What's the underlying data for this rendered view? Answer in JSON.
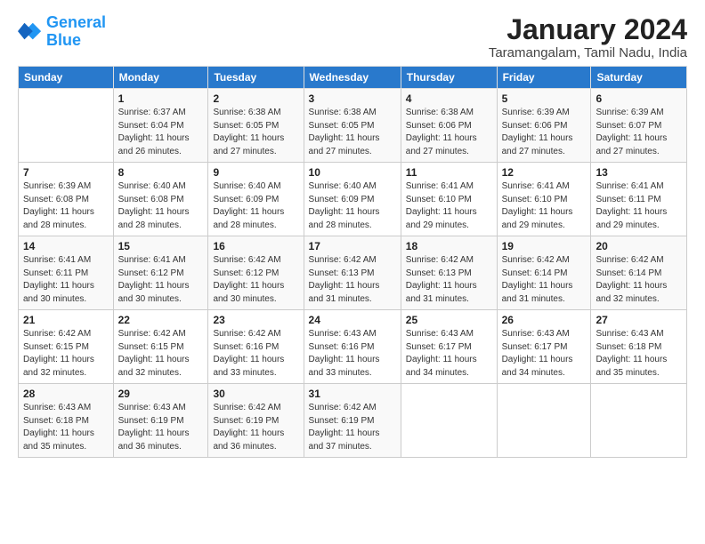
{
  "logo": {
    "line1": "General",
    "line2": "Blue"
  },
  "title": "January 2024",
  "subtitle": "Taramangalam, Tamil Nadu, India",
  "header": {
    "colors": {
      "bg": "#2979cc"
    }
  },
  "days_of_week": [
    "Sunday",
    "Monday",
    "Tuesday",
    "Wednesday",
    "Thursday",
    "Friday",
    "Saturday"
  ],
  "weeks": [
    [
      {
        "day": "",
        "info": ""
      },
      {
        "day": "1",
        "info": "Sunrise: 6:37 AM\nSunset: 6:04 PM\nDaylight: 11 hours\nand 26 minutes."
      },
      {
        "day": "2",
        "info": "Sunrise: 6:38 AM\nSunset: 6:05 PM\nDaylight: 11 hours\nand 27 minutes."
      },
      {
        "day": "3",
        "info": "Sunrise: 6:38 AM\nSunset: 6:05 PM\nDaylight: 11 hours\nand 27 minutes."
      },
      {
        "day": "4",
        "info": "Sunrise: 6:38 AM\nSunset: 6:06 PM\nDaylight: 11 hours\nand 27 minutes."
      },
      {
        "day": "5",
        "info": "Sunrise: 6:39 AM\nSunset: 6:06 PM\nDaylight: 11 hours\nand 27 minutes."
      },
      {
        "day": "6",
        "info": "Sunrise: 6:39 AM\nSunset: 6:07 PM\nDaylight: 11 hours\nand 27 minutes."
      }
    ],
    [
      {
        "day": "7",
        "info": "Sunrise: 6:39 AM\nSunset: 6:08 PM\nDaylight: 11 hours\nand 28 minutes."
      },
      {
        "day": "8",
        "info": "Sunrise: 6:40 AM\nSunset: 6:08 PM\nDaylight: 11 hours\nand 28 minutes."
      },
      {
        "day": "9",
        "info": "Sunrise: 6:40 AM\nSunset: 6:09 PM\nDaylight: 11 hours\nand 28 minutes."
      },
      {
        "day": "10",
        "info": "Sunrise: 6:40 AM\nSunset: 6:09 PM\nDaylight: 11 hours\nand 28 minutes."
      },
      {
        "day": "11",
        "info": "Sunrise: 6:41 AM\nSunset: 6:10 PM\nDaylight: 11 hours\nand 29 minutes."
      },
      {
        "day": "12",
        "info": "Sunrise: 6:41 AM\nSunset: 6:10 PM\nDaylight: 11 hours\nand 29 minutes."
      },
      {
        "day": "13",
        "info": "Sunrise: 6:41 AM\nSunset: 6:11 PM\nDaylight: 11 hours\nand 29 minutes."
      }
    ],
    [
      {
        "day": "14",
        "info": "Sunrise: 6:41 AM\nSunset: 6:11 PM\nDaylight: 11 hours\nand 30 minutes."
      },
      {
        "day": "15",
        "info": "Sunrise: 6:41 AM\nSunset: 6:12 PM\nDaylight: 11 hours\nand 30 minutes."
      },
      {
        "day": "16",
        "info": "Sunrise: 6:42 AM\nSunset: 6:12 PM\nDaylight: 11 hours\nand 30 minutes."
      },
      {
        "day": "17",
        "info": "Sunrise: 6:42 AM\nSunset: 6:13 PM\nDaylight: 11 hours\nand 31 minutes."
      },
      {
        "day": "18",
        "info": "Sunrise: 6:42 AM\nSunset: 6:13 PM\nDaylight: 11 hours\nand 31 minutes."
      },
      {
        "day": "19",
        "info": "Sunrise: 6:42 AM\nSunset: 6:14 PM\nDaylight: 11 hours\nand 31 minutes."
      },
      {
        "day": "20",
        "info": "Sunrise: 6:42 AM\nSunset: 6:14 PM\nDaylight: 11 hours\nand 32 minutes."
      }
    ],
    [
      {
        "day": "21",
        "info": "Sunrise: 6:42 AM\nSunset: 6:15 PM\nDaylight: 11 hours\nand 32 minutes."
      },
      {
        "day": "22",
        "info": "Sunrise: 6:42 AM\nSunset: 6:15 PM\nDaylight: 11 hours\nand 32 minutes."
      },
      {
        "day": "23",
        "info": "Sunrise: 6:42 AM\nSunset: 6:16 PM\nDaylight: 11 hours\nand 33 minutes."
      },
      {
        "day": "24",
        "info": "Sunrise: 6:43 AM\nSunset: 6:16 PM\nDaylight: 11 hours\nand 33 minutes."
      },
      {
        "day": "25",
        "info": "Sunrise: 6:43 AM\nSunset: 6:17 PM\nDaylight: 11 hours\nand 34 minutes."
      },
      {
        "day": "26",
        "info": "Sunrise: 6:43 AM\nSunset: 6:17 PM\nDaylight: 11 hours\nand 34 minutes."
      },
      {
        "day": "27",
        "info": "Sunrise: 6:43 AM\nSunset: 6:18 PM\nDaylight: 11 hours\nand 35 minutes."
      }
    ],
    [
      {
        "day": "28",
        "info": "Sunrise: 6:43 AM\nSunset: 6:18 PM\nDaylight: 11 hours\nand 35 minutes."
      },
      {
        "day": "29",
        "info": "Sunrise: 6:43 AM\nSunset: 6:19 PM\nDaylight: 11 hours\nand 36 minutes."
      },
      {
        "day": "30",
        "info": "Sunrise: 6:42 AM\nSunset: 6:19 PM\nDaylight: 11 hours\nand 36 minutes."
      },
      {
        "day": "31",
        "info": "Sunrise: 6:42 AM\nSunset: 6:19 PM\nDaylight: 11 hours\nand 37 minutes."
      },
      {
        "day": "",
        "info": ""
      },
      {
        "day": "",
        "info": ""
      },
      {
        "day": "",
        "info": ""
      }
    ]
  ]
}
